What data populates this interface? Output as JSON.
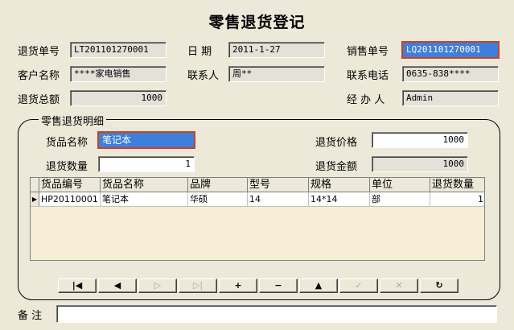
{
  "title": "零售退货登记",
  "form": {
    "return_no_label": "退货单号",
    "return_no": "LT201101270001",
    "date_label": "日  期",
    "date": "2011-1-27",
    "sale_no_label": "销售单号",
    "sale_no": "LQ201101270001",
    "customer_label": "客户名称",
    "customer": "****家电销售",
    "contact_label": "联系人",
    "contact": "周**",
    "phone_label": "联系电话",
    "phone": "0635-838****",
    "total_label": "退货总额",
    "total": "1000",
    "handler_label": "经 办 人",
    "handler": "Admin"
  },
  "detail": {
    "group_title": "零售退货明细",
    "product_label": "货品名称",
    "product": "笔记本",
    "price_label": "退货价格",
    "price": "1000",
    "qty_label": "退货数量",
    "qty": "1",
    "amount_label": "退货金额",
    "amount": "1000"
  },
  "grid": {
    "columns": [
      "货品编号",
      "货品名称",
      "品牌",
      "型号",
      "规格",
      "单位",
      "退货数量"
    ],
    "rows": [
      [
        "HP20110001",
        "笔记本",
        "华硕",
        "14",
        "14*14",
        "部",
        "1"
      ]
    ]
  },
  "nav_buttons": [
    {
      "icon": "first-record-icon",
      "glyph": "|◀",
      "enabled": true
    },
    {
      "icon": "prev-record-icon",
      "glyph": "◀",
      "enabled": true
    },
    {
      "icon": "next-record-icon",
      "glyph": "▷",
      "enabled": false
    },
    {
      "icon": "last-record-icon",
      "glyph": "▷|",
      "enabled": false
    },
    {
      "icon": "insert-icon",
      "glyph": "+",
      "enabled": true
    },
    {
      "icon": "delete-icon",
      "glyph": "−",
      "enabled": true
    },
    {
      "icon": "edit-icon",
      "glyph": "▲",
      "enabled": true
    },
    {
      "icon": "post-icon",
      "glyph": "✓",
      "enabled": false
    },
    {
      "icon": "cancel-icon",
      "glyph": "✕",
      "enabled": false
    },
    {
      "icon": "refresh-icon",
      "glyph": "↻",
      "enabled": true
    }
  ],
  "remarks_label": "备  注",
  "remarks": ""
}
